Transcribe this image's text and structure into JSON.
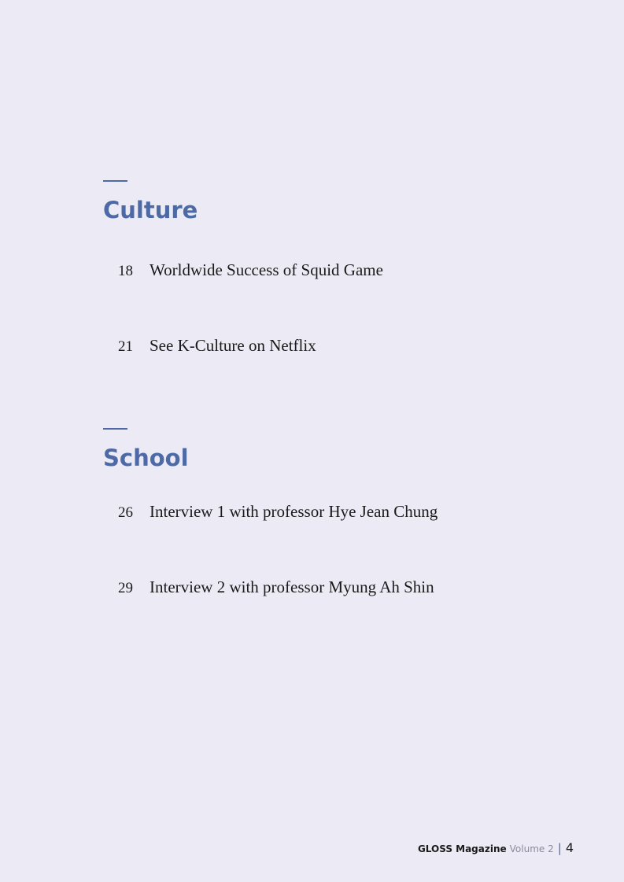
{
  "sections": [
    {
      "title": "Culture",
      "entries": [
        {
          "page": "18",
          "title": "Worldwide Success of Squid Game"
        },
        {
          "page": "21",
          "title": "See K-Culture on Netflix"
        }
      ]
    },
    {
      "title": "School",
      "entries": [
        {
          "page": "26",
          "title": "Interview 1 with professor Hye Jean Chung"
        },
        {
          "page": "29",
          "title": "Interview 2 with professor Myung Ah Shin"
        }
      ]
    }
  ],
  "footer": {
    "magazine": "GLOSS Magazine",
    "volume": "Volume 2",
    "separator": "|",
    "page_number": "4"
  },
  "colors": {
    "accent": "#4d6aa6",
    "background": "#ecebf5",
    "text": "#1a1a1a"
  }
}
